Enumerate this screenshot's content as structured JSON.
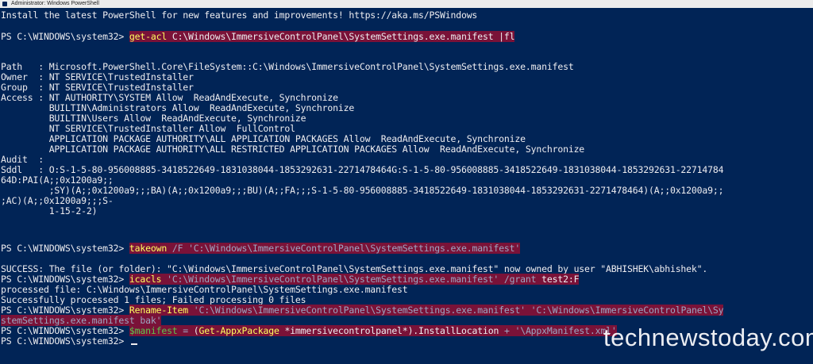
{
  "window": {
    "title": "Administrator: Windows PowerShell"
  },
  "watermark": "technewstoday.com",
  "colors": {
    "background": "#012456",
    "foreground": "#eeedf0",
    "command": "#ffff5f",
    "string": "#9da6c2",
    "variable": "#5ec54f",
    "highlight": "#7a1238"
  },
  "console": {
    "banner": "Install the latest PowerShell for new features and improvements! https://aka.ms/PSWindows",
    "prompt": "PS C:\\WINDOWS\\system32> ",
    "cmd1": {
      "cmdlet": "get-acl",
      "args": " C:\\Windows\\ImmersiveControlPanel\\SystemSettings.exe.manifest |fl"
    },
    "output": [
      "Path   : Microsoft.PowerShell.Core\\FileSystem::C:\\Windows\\ImmersiveControlPanel\\SystemSettings.exe.manifest",
      "Owner  : NT SERVICE\\TrustedInstaller",
      "Group  : NT SERVICE\\TrustedInstaller",
      "Access : NT AUTHORITY\\SYSTEM Allow  ReadAndExecute, Synchronize",
      "         BUILTIN\\Administrators Allow  ReadAndExecute, Synchronize",
      "         BUILTIN\\Users Allow  ReadAndExecute, Synchronize",
      "         NT SERVICE\\TrustedInstaller Allow  FullControl",
      "         APPLICATION PACKAGE AUTHORITY\\ALL APPLICATION PACKAGES Allow  ReadAndExecute, Synchronize",
      "         APPLICATION PACKAGE AUTHORITY\\ALL RESTRICTED APPLICATION PACKAGES Allow  ReadAndExecute, Synchronize",
      "Audit  :",
      "Sddl   : O:S-1-5-80-956008885-3418522649-1831038044-1853292631-2271478464G:S-1-5-80-956008885-3418522649-1831038044-1853292631-22714784",
      "64D:PAI(A;;0x1200a9;;",
      "         ;SY)(A;;0x1200a9;;;BA)(A;;0x1200a9;;;BU)(A;;FA;;;S-1-5-80-956008885-3418522649-1831038044-1853292631-2271478464)(A;;0x1200a9;;",
      ";AC)(A;;0x1200a9;;;S-",
      "         1-15-2-2)"
    ],
    "cmd2": {
      "cmdlet": "takeown",
      "param": " /F ",
      "path": "'C:\\Windows\\ImmersiveControlPanel\\SystemSettings.exe.manifest'"
    },
    "success_line": "SUCCESS: The file (or folder): \"C:\\Windows\\ImmersiveControlPanel\\SystemSettings.exe.manifest\" now owned by user \"ABHISHEK\\abhishek\".",
    "cmd3": {
      "cmdlet": "icacls",
      "path": " 'C:\\Windows\\ImmersiveControlPanel\\SystemSettings.exe.manifest'",
      "param": " /grant",
      "arg": " test2:F"
    },
    "processed_line": "processed file: C:\\Windows\\ImmersiveControlPanel\\SystemSettings.exe.manifest",
    "summary_line": "Successfully processed 1 files; Failed processing 0 files",
    "cmd4": {
      "cmdlet": "Rename-Item",
      "path1": " 'C:\\Windows\\ImmersiveControlPanel\\SystemSettings.exe.manifest'",
      "path2_part1": " 'C:\\Windows\\ImmersiveControlPanel\\Sy",
      "path2_part2": "stemSettings.exe.manifest_bak'"
    },
    "cmd5": {
      "variable": "$manifest",
      "op1": " = ",
      "expr_open": "(",
      "cmdlet": "Get-AppxPackage",
      "arg": " *immersivecontrolpanel*",
      "expr_close": ").InstallLocation",
      "op2": " + ",
      "str": "'\\AppxManifest.xml'"
    }
  }
}
